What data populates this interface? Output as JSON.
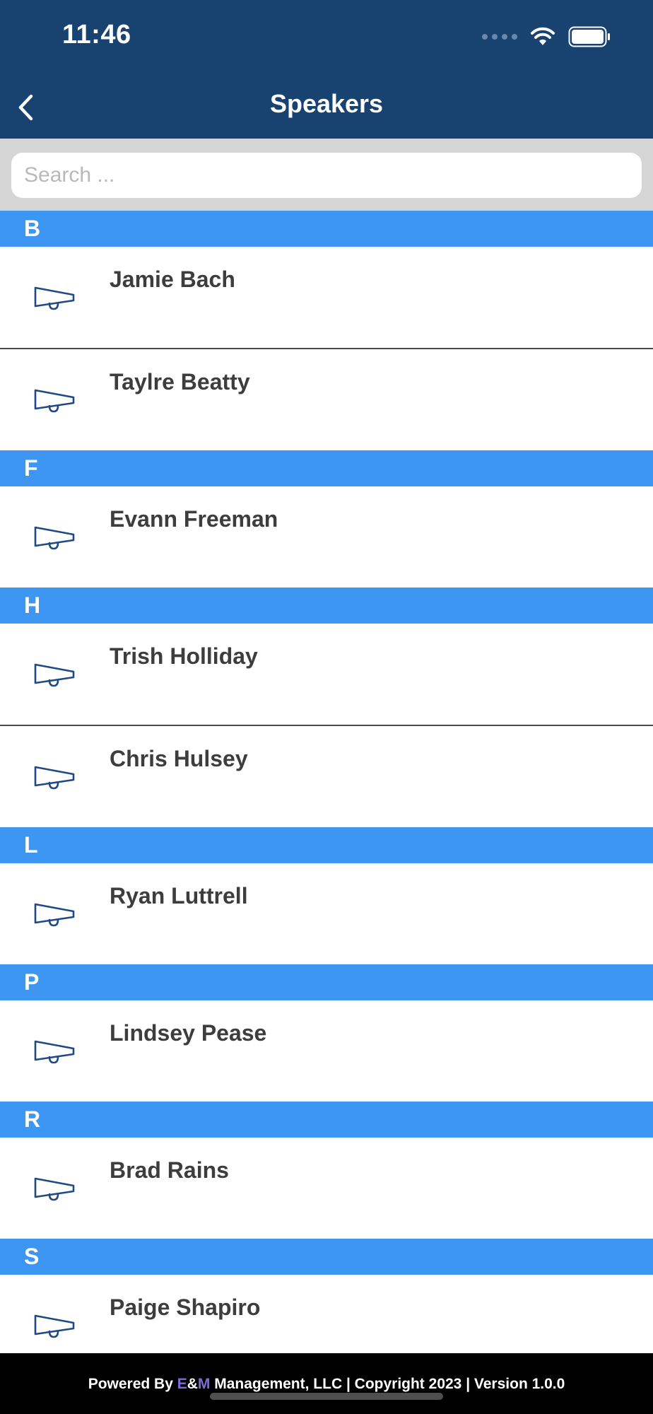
{
  "status": {
    "time": "11:46"
  },
  "nav": {
    "title": "Speakers"
  },
  "search": {
    "placeholder": "Search ..."
  },
  "sections": [
    {
      "letter": "B",
      "speakers": [
        "Jamie Bach",
        "Taylre Beatty"
      ]
    },
    {
      "letter": "F",
      "speakers": [
        "Evann Freeman"
      ]
    },
    {
      "letter": "H",
      "speakers": [
        "Trish Holliday",
        "Chris Hulsey"
      ]
    },
    {
      "letter": "L",
      "speakers": [
        "Ryan Luttrell"
      ]
    },
    {
      "letter": "P",
      "speakers": [
        "Lindsey Pease"
      ]
    },
    {
      "letter": "R",
      "speakers": [
        "Brad Rains"
      ]
    },
    {
      "letter": "S",
      "speakers": [
        "Paige Shapiro"
      ]
    }
  ],
  "row_icon": "megaphone-icon",
  "footer": {
    "prefix": "Powered By ",
    "brand_e": "E",
    "brand_amp": "&",
    "brand_m": "M",
    "suffix": " Management, LLC | Copyright 2023 | Version 1.0.0"
  },
  "colors": {
    "header_bg": "#184270",
    "section_bg": "#3d96f1",
    "brand_accent": "#7b6cd9"
  }
}
